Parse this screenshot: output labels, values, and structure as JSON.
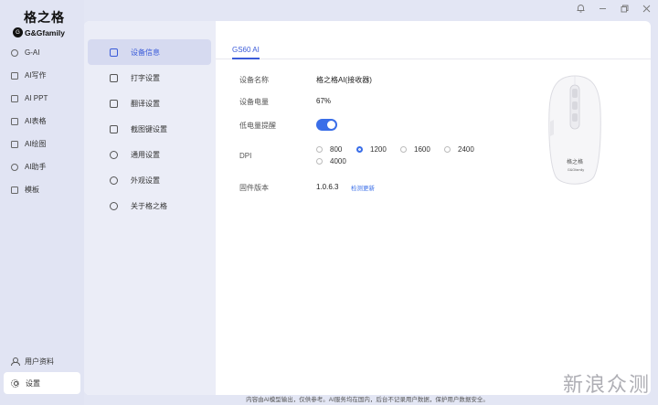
{
  "brand": {
    "name_cn": "格之格",
    "name_en": "G&Gfamily",
    "mark": "G"
  },
  "sidebar": {
    "items": [
      {
        "label": "G-AI",
        "icon": "g-ai-icon"
      },
      {
        "label": "AI写作",
        "icon": "doc-icon"
      },
      {
        "label": "AI PPT",
        "icon": "ppt-icon"
      },
      {
        "label": "AI表格",
        "icon": "table-icon"
      },
      {
        "label": "AI绘图",
        "icon": "paint-icon"
      },
      {
        "label": "AI助手",
        "icon": "assistant-icon"
      },
      {
        "label": "模板",
        "icon": "template-icon"
      }
    ],
    "bottom": [
      {
        "label": "用户资料",
        "icon": "user-icon"
      },
      {
        "label": "设置",
        "icon": "gear-icon",
        "active": true
      }
    ]
  },
  "window_controls": [
    "bell-icon",
    "minimize-icon",
    "restore-icon",
    "close-icon"
  ],
  "settings_nav": {
    "items": [
      {
        "label": "设备信息",
        "active": true
      },
      {
        "label": "打字设置"
      },
      {
        "label": "翻译设置"
      },
      {
        "label": "截图键设置"
      },
      {
        "label": "通用设置"
      },
      {
        "label": "外观设置"
      },
      {
        "label": "关于格之格"
      }
    ]
  },
  "device": {
    "tab": "GS60 AI",
    "name_label": "设备名称",
    "name_value": "格之格AI(接收器)",
    "battery_label": "设备电量",
    "battery_value": "67%",
    "low_battery_label": "低电量提醒",
    "low_battery_enabled": true,
    "dpi_label": "DPI",
    "dpi_options": [
      "800",
      "1200",
      "1600",
      "2400",
      "4000"
    ],
    "dpi_selected": "1200",
    "firmware_label": "固件版本",
    "firmware_value": "1.0.6.3",
    "firmware_link": "检测更新",
    "mouse_text": "格之格",
    "mouse_brand": "G&Gfamily"
  },
  "footer": "内容由AI模型输出，仅供参考。AI服务均在国内，后台不记录用户数据，保护用户数据安全。",
  "watermark": "新浪众测",
  "colors": {
    "accent": "#3a6ee8",
    "nav_active_bg": "#d6daf0"
  }
}
